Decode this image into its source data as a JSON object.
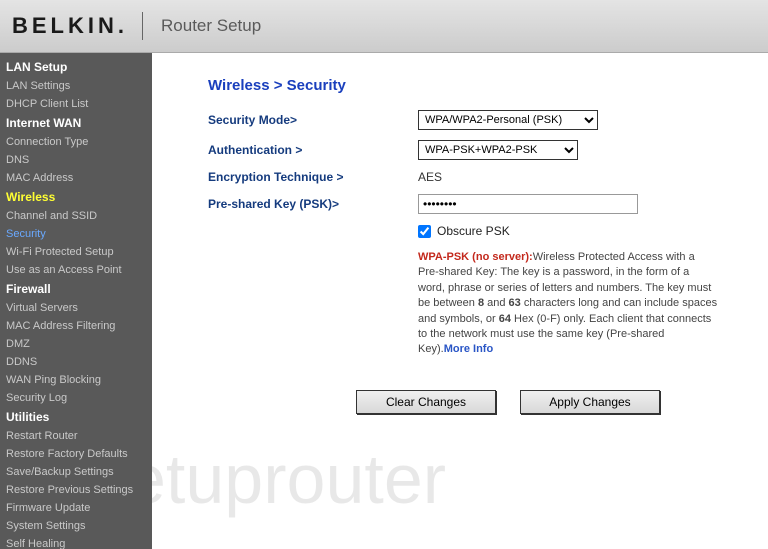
{
  "header": {
    "brand": "BELKIN",
    "title": "Router Setup"
  },
  "sidebar": {
    "sections": [
      {
        "heading": "LAN Setup",
        "items": [
          "LAN Settings",
          "DHCP Client List"
        ]
      },
      {
        "heading": "Internet WAN",
        "items": [
          "Connection Type",
          "DNS",
          "MAC Address"
        ]
      },
      {
        "heading": "Wireless",
        "active": true,
        "items": [
          "Channel and SSID",
          "Security",
          "Wi-Fi Protected Setup",
          "Use as an Access Point"
        ],
        "activeItem": "Security"
      },
      {
        "heading": "Firewall",
        "items": [
          "Virtual Servers",
          "MAC Address Filtering",
          "DMZ",
          "DDNS",
          "WAN Ping Blocking",
          "Security Log"
        ]
      },
      {
        "heading": "Utilities",
        "items": [
          "Restart Router",
          "Restore Factory Defaults",
          "Save/Backup Settings",
          "Restore Previous Settings",
          "Firmware Update",
          "System Settings",
          "Self Healing"
        ]
      }
    ]
  },
  "page": {
    "breadcrumb": "Wireless > Security",
    "labels": {
      "security_mode": "Security Mode>",
      "authentication": "Authentication >",
      "encryption": "Encryption Technique >",
      "psk": "Pre-shared Key (PSK)>",
      "obscure": "Obscure PSK"
    },
    "values": {
      "security_mode": "WPA/WPA2-Personal (PSK)",
      "authentication": "WPA-PSK+WPA2-PSK",
      "encryption": "AES",
      "psk_display": "••••••••",
      "obscure_checked": true
    },
    "info": {
      "title": "WPA-PSK (no server):",
      "body1": "Wireless Protected Access with a Pre-shared Key: The key is a password, in the form of a word, phrase or series of letters and numbers. The key must be between ",
      "b8": "8",
      "body2": " and ",
      "b63": "63",
      "body3": " characters long and can include spaces and symbols, or ",
      "b64": "64",
      "body4": " Hex (0-F) only. Each client that connects to the network must use the same key (Pre-shared Key).",
      "more": "More Info"
    },
    "buttons": {
      "clear": "Clear Changes",
      "apply": "Apply Changes"
    }
  },
  "watermark": "setuprouter"
}
